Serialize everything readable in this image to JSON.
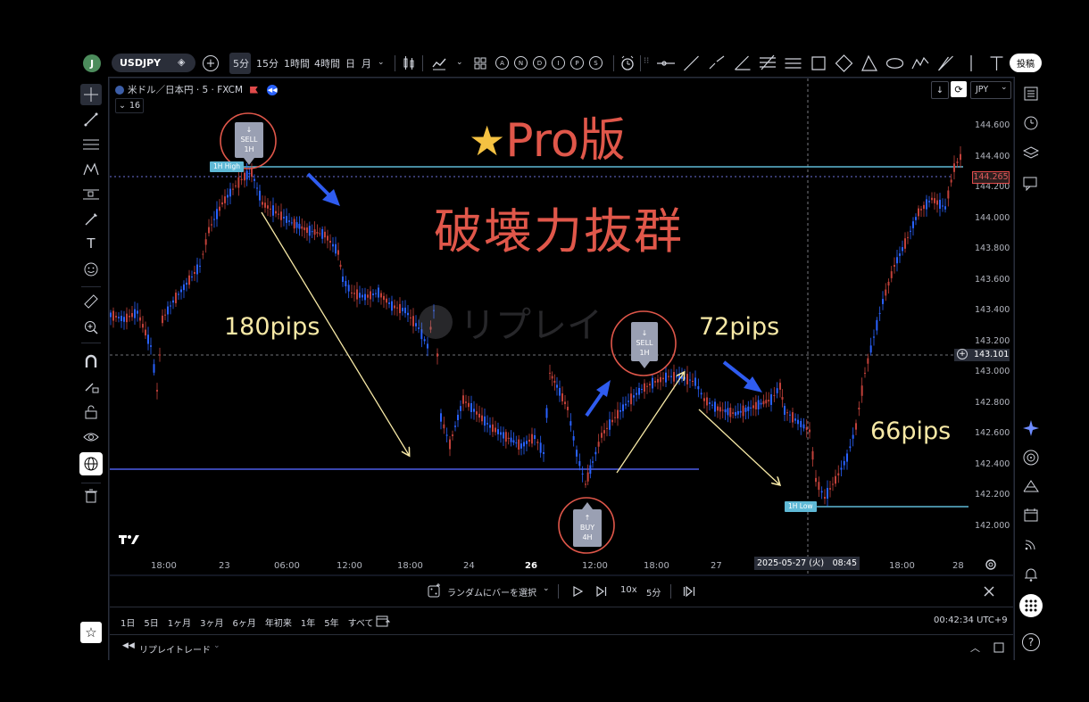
{
  "topbar": {
    "avatar": "J",
    "symbol": "USDJPY",
    "intervals": [
      "5分",
      "15分",
      "1時間",
      "4時間",
      "日",
      "月"
    ],
    "indicator_letters": [
      "A",
      "N",
      "D",
      "I",
      "P",
      "S"
    ],
    "publish_label": "投稿"
  },
  "legend": {
    "symbol_line": "米ドル／日本円 · 5 · FXCM",
    "collapse_count": "16"
  },
  "currency": "JPY",
  "price_axis": {
    "ticks": [
      "144.600",
      "144.400",
      "144.200",
      "144.000",
      "143.800",
      "143.600",
      "143.400",
      "143.200",
      "143.000",
      "142.800",
      "142.600",
      "142.400",
      "142.200",
      "142.000"
    ],
    "last_price": "144.265",
    "crosshair_price": "143.101"
  },
  "time_axis": {
    "ticks": [
      "18:00",
      "23",
      "06:00",
      "12:00",
      "18:00",
      "24",
      "26",
      "12:00",
      "18:00",
      "27",
      "18:00",
      "28"
    ],
    "crosshair_time": "2025-05-27 (火)　08:45"
  },
  "annotations": {
    "pro_title": "Pro版",
    "tagline": "破壊力抜群",
    "pips_180": "180pips",
    "pips_72": "72pips",
    "pips_66": "66pips",
    "watermark": "リプレイ",
    "high_label": "1H High",
    "low_label": "1H Low",
    "sell1_arrow": "↓",
    "sell1_text": "SELL",
    "sell1_tf": "1H",
    "sell2_arrow": "↓",
    "sell2_text": "SELL",
    "sell2_tf": "1H",
    "buy_arrow": "↑",
    "buy_text": "BUY",
    "buy_tf": "4H"
  },
  "replay": {
    "random_bar_label": "ランダムにバーを選択",
    "speed": "10x",
    "interval": "5分"
  },
  "bottom": {
    "ranges": [
      "1日",
      "5日",
      "1ヶ月",
      "3ヶ月",
      "6ヶ月",
      "年初来",
      "1年",
      "5年",
      "すべて"
    ],
    "clock": "00:42:34 UTC+9",
    "replay_trade": "リプレイトレード"
  },
  "colors": {
    "accent": "#2962ff",
    "annotation_red": "#e0574a",
    "pips_yellow": "#f7e9a6",
    "level_line": "#5fb9d6",
    "support_line": "#4c5ee8"
  }
}
